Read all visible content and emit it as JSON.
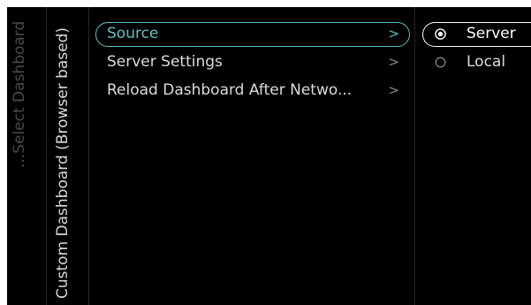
{
  "breadcrumb": {
    "grandparent": "...Select Dashboard",
    "parent": "Custom Dashboard (Browser based)"
  },
  "menu": {
    "items": [
      {
        "label": "Source",
        "chevron": ">",
        "selected": true
      },
      {
        "label": "Server Settings",
        "chevron": ">",
        "selected": false
      },
      {
        "label": "Reload Dashboard After Netwo...",
        "chevron": ">",
        "selected": false
      }
    ]
  },
  "options": {
    "items": [
      {
        "label": "Server",
        "checked": true,
        "focused": true
      },
      {
        "label": "Local",
        "checked": false,
        "focused": false
      }
    ]
  },
  "colors": {
    "accent": "#5fc2c0",
    "background": "#000000",
    "text": "#dcdcdc",
    "breadcrumb_text": "#4b4b4b"
  },
  "icons": {
    "radio_checked": "radio-checked-icon",
    "radio_unchecked": "radio-unchecked-icon",
    "chevron": "chevron-right-icon"
  }
}
